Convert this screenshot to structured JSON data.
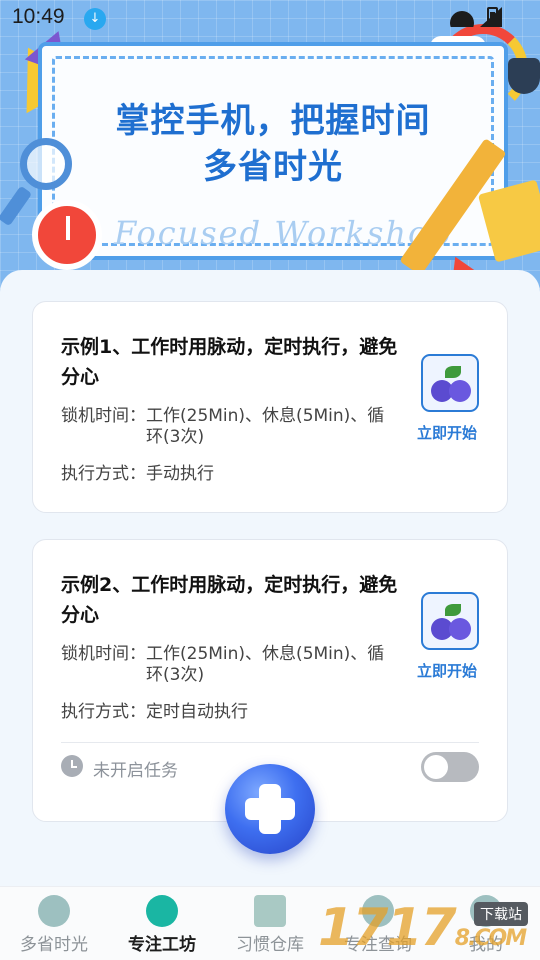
{
  "status_bar": {
    "time": "10:49"
  },
  "banner": {
    "headline_line1": "掌控手机，把握时间",
    "headline_line2": "多省时光",
    "watermark_text": "Focused Workshop"
  },
  "cards": [
    {
      "title": "示例1、工作时用脉动，定时执行，避免分心",
      "lock_time_label": "锁机时间：",
      "lock_time_value": "工作(25Min)、休息(5Min)、循环(3次)",
      "exec_label": "执行方式：",
      "exec_value": "手动执行",
      "start_label": "立即开始",
      "icon": "blueberry-app-icon"
    },
    {
      "title": "示例2、工作时用脉动，定时执行，避免分心",
      "lock_time_label": "锁机时间：",
      "lock_time_value": "工作(25Min)、休息(5Min)、循环(3次)",
      "exec_label": "执行方式：",
      "exec_value": "定时自动执行",
      "start_label": "立即开始",
      "icon": "blueberry-app-icon",
      "task_status": "未开启任务",
      "toggle_on": false
    }
  ],
  "fab": {
    "icon": "plus-icon"
  },
  "tabbar": {
    "tabs": [
      {
        "label": "多省时光",
        "icon": "alarm-clock-icon",
        "active": false
      },
      {
        "label": "专注工坊",
        "icon": "lightbulb-icon",
        "active": true
      },
      {
        "label": "习惯仓库",
        "icon": "cube-icon",
        "active": false
      },
      {
        "label": "专注查询",
        "icon": "search-icon",
        "active": false
      },
      {
        "label": "我的",
        "icon": "user-icon",
        "active": false
      }
    ]
  },
  "site_watermark": {
    "text": "1717",
    "suffix": "8.COM",
    "badge": "下载站"
  },
  "colors": {
    "accent": "#2b7bd6",
    "headline": "#1f6fd0",
    "tab_active": "#1ab6a3",
    "toggle_off": "#b7babf"
  }
}
